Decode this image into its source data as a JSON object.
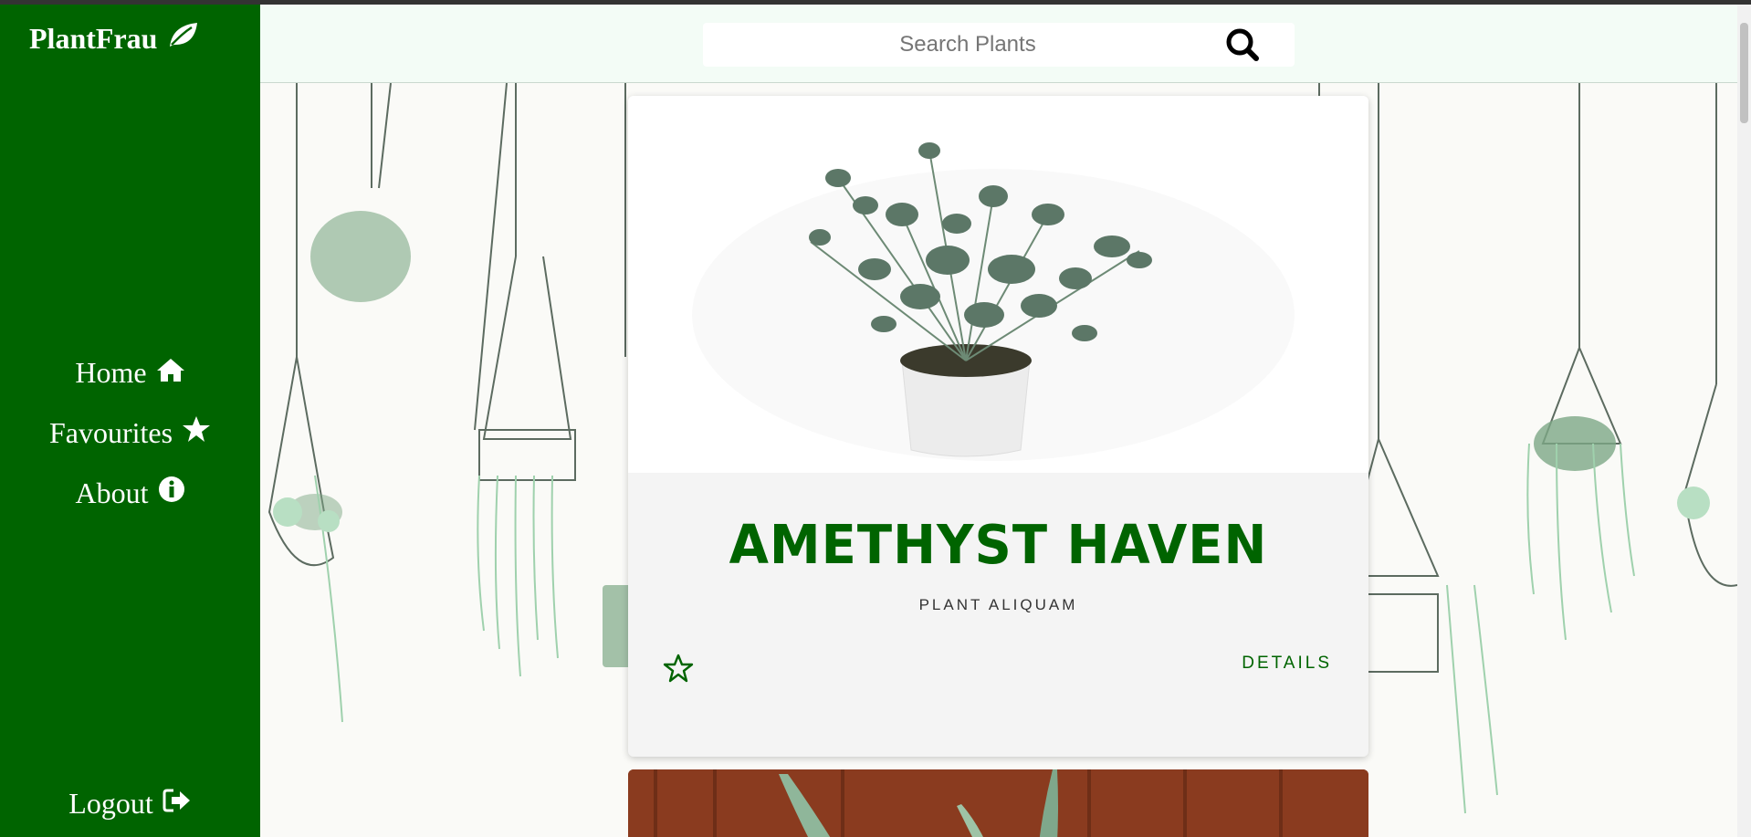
{
  "sidebar": {
    "brand": "PlantFrau",
    "brand_icon": "leaf-icon",
    "items": [
      {
        "label": "Home",
        "icon": "home-icon"
      },
      {
        "label": "Favourites",
        "icon": "star-icon"
      },
      {
        "label": "About",
        "icon": "info-icon"
      }
    ],
    "logout": {
      "label": "Logout",
      "icon": "sign-out-icon"
    }
  },
  "header": {
    "search_placeholder": "Search Plants",
    "search_icon": "search-icon"
  },
  "card": {
    "title": "AMETHYST HAVEN",
    "subtitle": "PLANT ALIQUAM",
    "favourite_icon": "star-outline-icon",
    "details_label": "DETAILS"
  },
  "colors": {
    "primary": "#006400",
    "header_bg": "#f3fcf6",
    "card_bg": "#f4f4f4"
  }
}
